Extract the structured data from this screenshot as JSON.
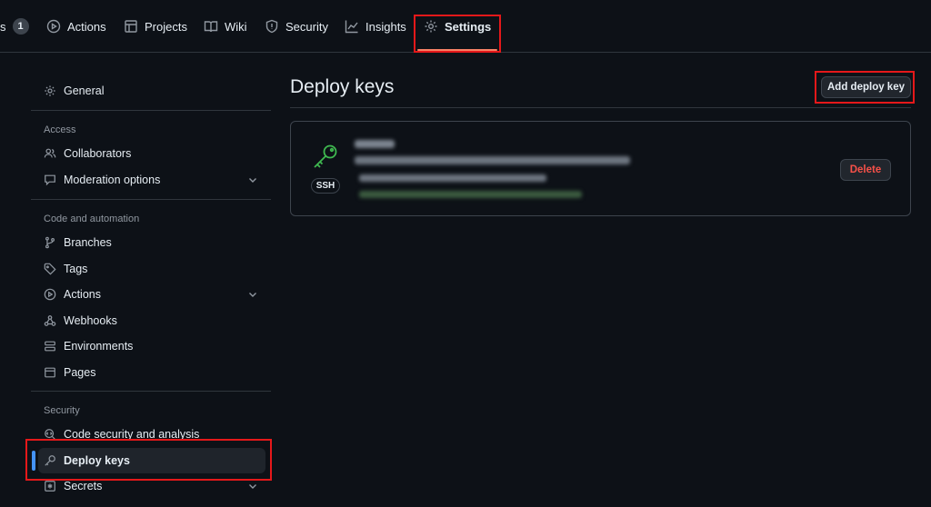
{
  "topnav": {
    "partial_tab_label": "s",
    "partial_tab_count": "1",
    "tabs": [
      {
        "label": "Actions",
        "icon": "play-icon"
      },
      {
        "label": "Projects",
        "icon": "table-icon"
      },
      {
        "label": "Wiki",
        "icon": "book-icon"
      },
      {
        "label": "Security",
        "icon": "shield-icon"
      },
      {
        "label": "Insights",
        "icon": "graph-icon"
      },
      {
        "label": "Settings",
        "icon": "gear-icon",
        "active": true
      }
    ]
  },
  "sidebar": {
    "general": "General",
    "access_heading": "Access",
    "collaborators": "Collaborators",
    "moderation": "Moderation options",
    "code_heading": "Code and automation",
    "branches": "Branches",
    "tags": "Tags",
    "actions": "Actions",
    "webhooks": "Webhooks",
    "environments": "Environments",
    "pages": "Pages",
    "security_heading": "Security",
    "code_security": "Code security and analysis",
    "deploy_keys": "Deploy keys",
    "secrets": "Secrets"
  },
  "main": {
    "title": "Deploy keys",
    "add_button": "Add deploy key",
    "key": {
      "type_badge": "SSH",
      "delete_button": "Delete"
    }
  },
  "colors": {
    "background": "#0d1117",
    "border": "#30363d",
    "accent_blue": "#4493f8",
    "key_green": "#3fb950",
    "danger": "#f85149",
    "highlight_red": "#e5181a"
  }
}
